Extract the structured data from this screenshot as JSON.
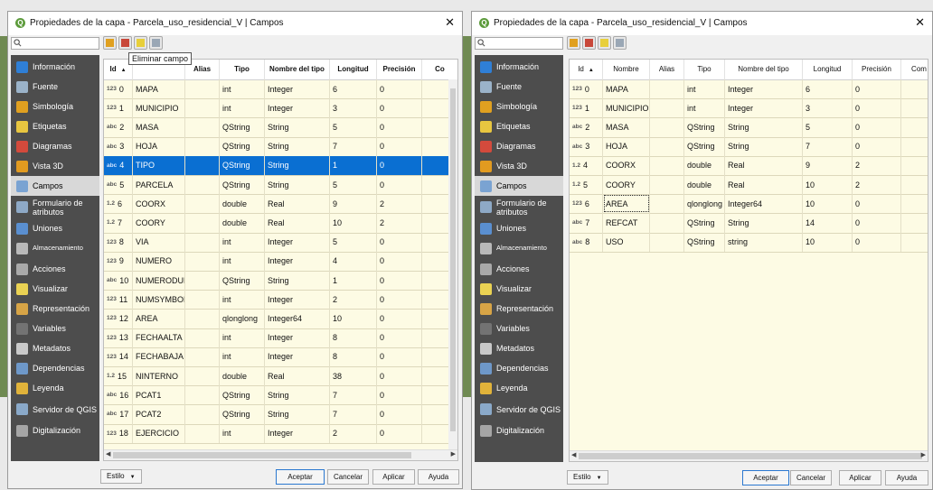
{
  "window_title": "Propiedades de la capa - Parcela_uso_residencial_V | Campos",
  "app_icon": "qgis-logo-icon",
  "close_glyph": "✕",
  "sidebar": [
    {
      "label": "Información",
      "icon": "info-icon",
      "color": "#2f7fd6"
    },
    {
      "label": "Fuente",
      "icon": "source-icon",
      "color": "#9bb3c9"
    },
    {
      "label": "Simbología",
      "icon": "symbology-icon",
      "color": "#e0a020"
    },
    {
      "label": "Etiquetas",
      "icon": "labels-icon",
      "color": "#e8c640"
    },
    {
      "label": "Diagramas",
      "icon": "diagrams-icon",
      "color": "#d34a3c"
    },
    {
      "label": "Vista 3D",
      "icon": "view3d-icon",
      "color": "#e29b20"
    },
    {
      "label": "Campos",
      "icon": "fields-icon",
      "color": "#7aa3d2"
    },
    {
      "label": "Formulario de atributos",
      "icon": "form-icon",
      "color": "#8ea9c6"
    },
    {
      "label": "Uniones",
      "icon": "joins-icon",
      "color": "#5a8fd0"
    },
    {
      "label": "Almacenamiento",
      "icon": "storage-icon",
      "color": "#b9b9b9"
    },
    {
      "label": "Acciones",
      "icon": "actions-icon",
      "color": "#a9a9a9"
    },
    {
      "label": "Visualizar",
      "icon": "display-icon",
      "color": "#ead253"
    },
    {
      "label": "Representación",
      "icon": "rendering-icon",
      "color": "#d7a446"
    },
    {
      "label": "Variables",
      "icon": "variables-icon",
      "color": "#737373"
    },
    {
      "label": "Metadatos",
      "icon": "metadata-icon",
      "color": "#c9c9c9"
    },
    {
      "label": "Dependencias",
      "icon": "dependencies-icon",
      "color": "#6e98c9"
    },
    {
      "label": "Leyenda",
      "icon": "legend-icon",
      "color": "#e1b33a"
    },
    {
      "label": "Servidor de QGIS",
      "icon": "server-icon",
      "color": "#8aa9c9"
    },
    {
      "label": "Digitalización",
      "icon": "digitizing-icon",
      "color": "#a5a5a5"
    }
  ],
  "toolbar_icons": [
    "new-field-icon",
    "delete-field-icon",
    "toggle-edit-icon",
    "field-calculator-icon"
  ],
  "tooltip": "Eliminar campo",
  "left": {
    "columns": [
      "Id",
      "Alias",
      "Tipo",
      "Nombre del tipo",
      "Longitud",
      "Precisión",
      "Co"
    ],
    "sort_glyph": "▲",
    "rows": [
      {
        "tag": "123",
        "id": "0",
        "name": "MAPA",
        "type": "int",
        "type_name": "Integer",
        "length": "6",
        "precision": "0"
      },
      {
        "tag": "123",
        "id": "1",
        "name": "MUNICIPIO",
        "type": "int",
        "type_name": "Integer",
        "length": "3",
        "precision": "0"
      },
      {
        "tag": "abc",
        "id": "2",
        "name": "MASA",
        "type": "QString",
        "type_name": "String",
        "length": "5",
        "precision": "0"
      },
      {
        "tag": "abc",
        "id": "3",
        "name": "HOJA",
        "type": "QString",
        "type_name": "String",
        "length": "7",
        "precision": "0"
      },
      {
        "tag": "abc",
        "id": "4",
        "name": "TIPO",
        "type": "QString",
        "type_name": "String",
        "length": "1",
        "precision": "0"
      },
      {
        "tag": "abc",
        "id": "5",
        "name": "PARCELA",
        "type": "QString",
        "type_name": "String",
        "length": "5",
        "precision": "0"
      },
      {
        "tag": "1.2",
        "id": "6",
        "name": "COORX",
        "type": "double",
        "type_name": "Real",
        "length": "9",
        "precision": "2"
      },
      {
        "tag": "1.2",
        "id": "7",
        "name": "COORY",
        "type": "double",
        "type_name": "Real",
        "length": "10",
        "precision": "2"
      },
      {
        "tag": "123",
        "id": "8",
        "name": "VIA",
        "type": "int",
        "type_name": "Integer",
        "length": "5",
        "precision": "0"
      },
      {
        "tag": "123",
        "id": "9",
        "name": "NUMERO",
        "type": "int",
        "type_name": "Integer",
        "length": "4",
        "precision": "0"
      },
      {
        "tag": "abc",
        "id": "10",
        "name": "NUMERODUP",
        "type": "QString",
        "type_name": "String",
        "length": "1",
        "precision": "0"
      },
      {
        "tag": "123",
        "id": "11",
        "name": "NUMSYMBOL",
        "type": "int",
        "type_name": "Integer",
        "length": "2",
        "precision": "0"
      },
      {
        "tag": "123",
        "id": "12",
        "name": "AREA",
        "type": "qlonglong",
        "type_name": "Integer64",
        "length": "10",
        "precision": "0"
      },
      {
        "tag": "123",
        "id": "13",
        "name": "FECHAALTA",
        "type": "int",
        "type_name": "Integer",
        "length": "8",
        "precision": "0"
      },
      {
        "tag": "123",
        "id": "14",
        "name": "FECHABAJA",
        "type": "int",
        "type_name": "Integer",
        "length": "8",
        "precision": "0"
      },
      {
        "tag": "1.2",
        "id": "15",
        "name": "NINTERNO",
        "type": "double",
        "type_name": "Real",
        "length": "38",
        "precision": "0"
      },
      {
        "tag": "abc",
        "id": "16",
        "name": "PCAT1",
        "type": "QString",
        "type_name": "String",
        "length": "7",
        "precision": "0"
      },
      {
        "tag": "abc",
        "id": "17",
        "name": "PCAT2",
        "type": "QString",
        "type_name": "String",
        "length": "7",
        "precision": "0"
      },
      {
        "tag": "123",
        "id": "18",
        "name": "EJERCICIO",
        "type": "int",
        "type_name": "Integer",
        "length": "2",
        "precision": "0"
      }
    ]
  },
  "right": {
    "columns": [
      "Id",
      "Nombre",
      "Alias",
      "Tipo",
      "Nombre del tipo",
      "Longitud",
      "Precisión",
      "Com"
    ],
    "sort_glyph": "▲",
    "rows": [
      {
        "tag": "123",
        "id": "0",
        "name": "MAPA",
        "type": "int",
        "type_name": "Integer",
        "length": "6",
        "precision": "0"
      },
      {
        "tag": "123",
        "id": "1",
        "name": "MUNICIPIO",
        "type": "int",
        "type_name": "Integer",
        "length": "3",
        "precision": "0"
      },
      {
        "tag": "abc",
        "id": "2",
        "name": "MASA",
        "type": "QString",
        "type_name": "String",
        "length": "5",
        "precision": "0"
      },
      {
        "tag": "abc",
        "id": "3",
        "name": "HOJA",
        "type": "QString",
        "type_name": "String",
        "length": "7",
        "precision": "0"
      },
      {
        "tag": "1.2",
        "id": "4",
        "name": "COORX",
        "type": "double",
        "type_name": "Real",
        "length": "9",
        "precision": "2"
      },
      {
        "tag": "1.2",
        "id": "5",
        "name": "COORY",
        "type": "double",
        "type_name": "Real",
        "length": "10",
        "precision": "2"
      },
      {
        "tag": "123",
        "id": "6",
        "name": "AREA",
        "type": "qlonglong",
        "type_name": "Integer64",
        "length": "10",
        "precision": "0"
      },
      {
        "tag": "abc",
        "id": "7",
        "name": "REFCAT",
        "type": "QString",
        "type_name": "String",
        "length": "14",
        "precision": "0"
      },
      {
        "tag": "abc",
        "id": "8",
        "name": "USO",
        "type": "QString",
        "type_name": "string",
        "length": "10",
        "precision": "0"
      }
    ]
  },
  "bottom": {
    "style_label": "Estilo",
    "style_arrow": "▼",
    "ok": "Aceptar",
    "cancel": "Cancelar",
    "apply": "Aplicar",
    "help": "Ayuda"
  },
  "colors": {
    "selection": "#0a6fd2",
    "grid_bg": "#fdfbe4",
    "sidebar_bg": "#4d4d4d"
  }
}
